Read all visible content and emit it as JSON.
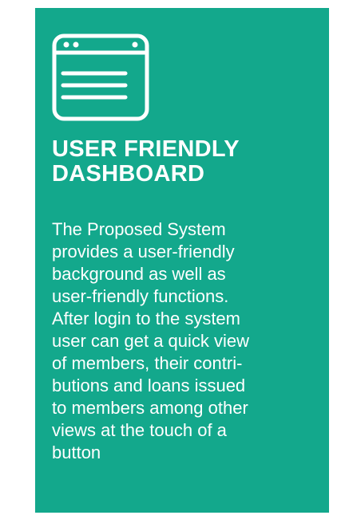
{
  "card": {
    "icon": "browser-window-icon",
    "accent_color": "#13a88c",
    "title_lines": [
      "USER FRIENDLY",
      "DASHBOARD"
    ],
    "description_lines": [
      "The Proposed System",
      "provides a user-friendly",
      "background as well as",
      "user-friendly functions.",
      "After login to the system",
      "user can get a quick view",
      "of members, their contri-",
      "butions and loans issued",
      "to members among other",
      "views at the touch of a",
      "button"
    ]
  }
}
